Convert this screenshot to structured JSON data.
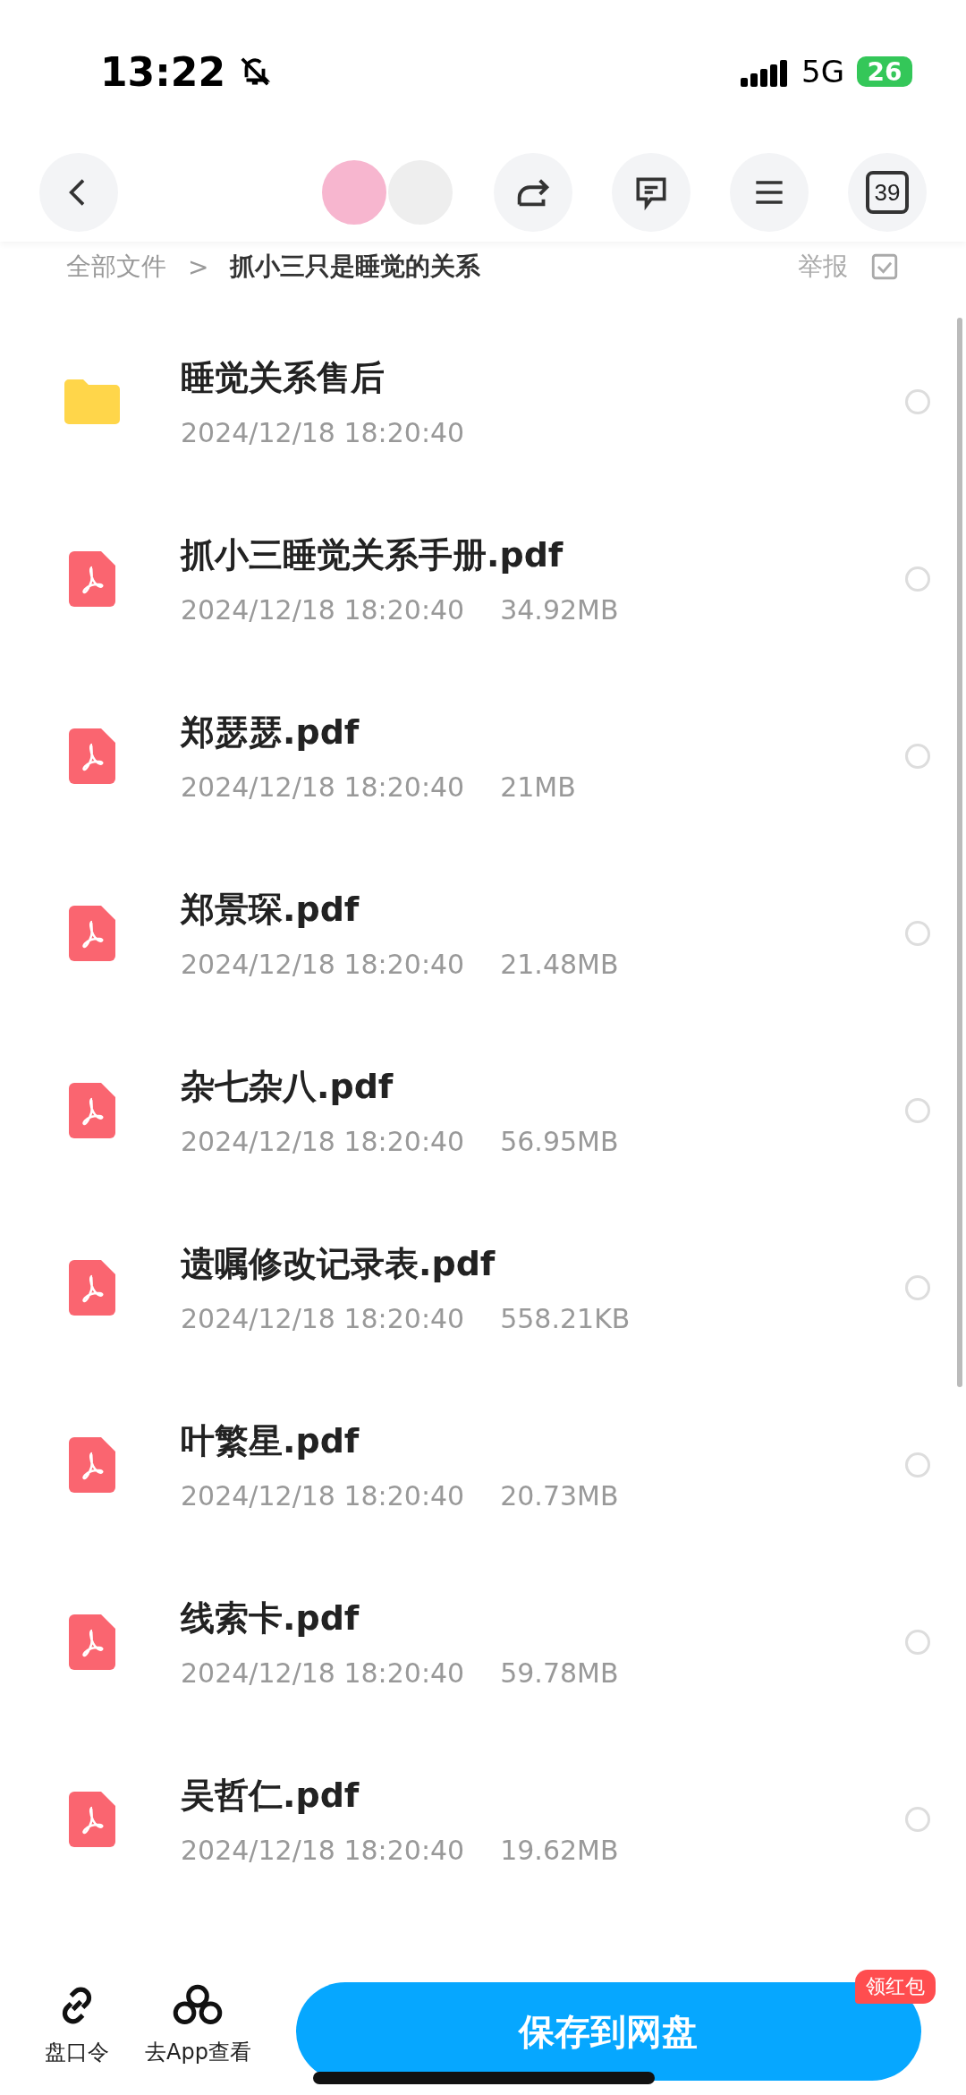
{
  "status_bar": {
    "time": "13:22",
    "network": "5G",
    "battery": "26"
  },
  "header": {
    "badge_number": "39"
  },
  "breadcrumb": {
    "root": "全部文件",
    "separator": ">",
    "current": "抓小三只是睡觉的关系",
    "report": "举报"
  },
  "files": [
    {
      "kind": "folder",
      "name": "睡觉关系售后",
      "date": "2024/12/18 18:20:40",
      "selected": false
    },
    {
      "kind": "pdf",
      "name": "抓小三睡觉关系手册.pdf",
      "date": "2024/12/18 18:20:40",
      "size": "34.92MB",
      "selected": false
    },
    {
      "kind": "pdf",
      "name": "郑瑟瑟.pdf",
      "date": "2024/12/18 18:20:40",
      "size": "21MB",
      "selected": false
    },
    {
      "kind": "pdf",
      "name": "郑景琛.pdf",
      "date": "2024/12/18 18:20:40",
      "size": "21.48MB",
      "selected": false
    },
    {
      "kind": "pdf",
      "name": "杂七杂八.pdf",
      "date": "2024/12/18 18:20:40",
      "size": "56.95MB",
      "selected": false
    },
    {
      "kind": "pdf",
      "name": "遗嘱修改记录表.pdf",
      "date": "2024/12/18 18:20:40",
      "size": "558.21KB",
      "selected": false
    },
    {
      "kind": "pdf",
      "name": "叶繁星.pdf",
      "date": "2024/12/18 18:20:40",
      "size": "20.73MB",
      "selected": false
    },
    {
      "kind": "pdf",
      "name": "线索卡.pdf",
      "date": "2024/12/18 18:20:40",
      "size": "59.78MB",
      "selected": false
    },
    {
      "kind": "pdf",
      "name": "吴哲仁.pdf",
      "date": "2024/12/18 18:20:40",
      "size": "19.62MB",
      "selected": false
    }
  ],
  "bottom_bar": {
    "share_code": "盘口令",
    "open_app": "去App查看",
    "save_button": "保存到网盘",
    "promo_badge": "领红包"
  }
}
